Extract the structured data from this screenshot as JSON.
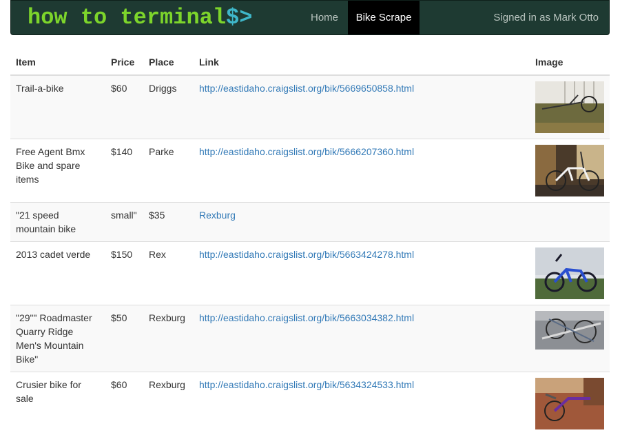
{
  "navbar": {
    "brand_text": "how to terminal",
    "brand_prompt": "$>",
    "home_label": "Home",
    "bike_scrape_label": "Bike Scrape",
    "signed_in": "Signed in as Mark Otto"
  },
  "table": {
    "headers": {
      "item": "Item",
      "price": "Price",
      "place": "Place",
      "link": "Link",
      "image": "Image"
    },
    "rows": [
      {
        "item": "Trail-a-bike",
        "price": "$60",
        "place": "Driggs",
        "link": "http://eastidaho.craigslist.org/bik/5669650858.html",
        "image": "photo of a trail-a-bike on grass by a white wall"
      },
      {
        "item": "Free Agent Bmx Bike and spare items",
        "price": "$140",
        "place": "Parke",
        "link": "http://eastidaho.craigslist.org/bik/5666207360.html",
        "image": "photo of a white BMX bike in a garage"
      },
      {
        "item": "\"21 speed mountain bike",
        "price": "small\"",
        "place": "$35",
        "link": "Rexburg",
        "image": ""
      },
      {
        "item": "2013 cadet verde",
        "price": "$150",
        "place": "Rex",
        "link": "http://eastidaho.craigslist.org/bik/5663424278.html",
        "image": "photo of a blue BMX bike leaning on a house"
      },
      {
        "item": "\"29\"\" Roadmaster Quarry Ridge Men's Mountain Bike\"",
        "price": "$50",
        "place": "Rexburg",
        "link": "http://eastidaho.craigslist.org/bik/5663034382.html",
        "image": "photo of several bikes in a truck bed"
      },
      {
        "item": "Crusier bike for sale",
        "price": "$60",
        "place": "Rexburg",
        "link": "http://eastidaho.craigslist.org/bik/5634324533.html",
        "image": "photo of a purple cruiser bike on a deck"
      }
    ]
  },
  "colors": {
    "navbar_bg": "#1e3a32",
    "brand_green": "#7dd52b",
    "brand_prompt": "#3fb7c9",
    "link": "#337ab7"
  }
}
